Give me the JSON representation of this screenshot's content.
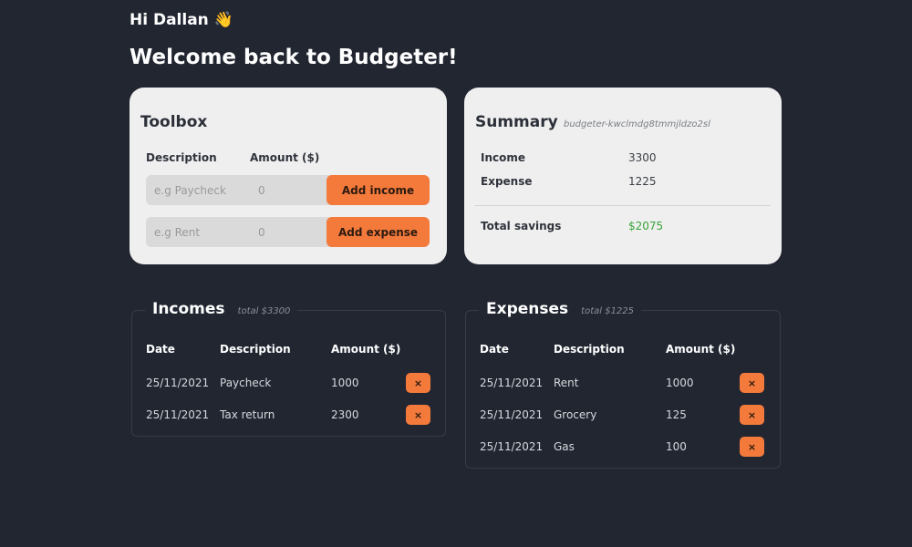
{
  "header": {
    "greeting": "Hi Dallan",
    "wave_emoji": "👋",
    "welcome": "Welcome back to Budgeter!"
  },
  "toolbox": {
    "title": "Toolbox",
    "col_description": "Description",
    "col_amount": "Amount ($)",
    "income_row": {
      "description_placeholder": "e.g Paycheck",
      "amount_placeholder": "0",
      "button_label": "Add income"
    },
    "expense_row": {
      "description_placeholder": "e.g Rent",
      "amount_placeholder": "0",
      "button_label": "Add expense"
    }
  },
  "summary": {
    "title": "Summary",
    "budget_id": "budgeter-kwclmdg8tmmjldzo2sl",
    "income_label": "Income",
    "income_value": "3300",
    "expense_label": "Expense",
    "expense_value": "1225",
    "savings_label": "Total savings",
    "savings_value": "$2075",
    "savings_color": "#3aa33a"
  },
  "incomes": {
    "title": "Incomes",
    "total": "total $3300",
    "headers": {
      "date": "Date",
      "description": "Description",
      "amount": "Amount ($)"
    },
    "rows": [
      {
        "date": "25/11/2021",
        "description": "Paycheck",
        "amount": "1000",
        "delete_label": "×"
      },
      {
        "date": "25/11/2021",
        "description": "Tax return",
        "amount": "2300",
        "delete_label": "×"
      }
    ]
  },
  "expenses": {
    "title": "Expenses",
    "total": "total $1225",
    "headers": {
      "date": "Date",
      "description": "Description",
      "amount": "Amount ($)"
    },
    "rows": [
      {
        "date": "25/11/2021",
        "description": "Rent",
        "amount": "1000",
        "delete_label": "×"
      },
      {
        "date": "25/11/2021",
        "description": "Grocery",
        "amount": "125",
        "delete_label": "×"
      },
      {
        "date": "25/11/2021",
        "description": "Gas",
        "amount": "100",
        "delete_label": "×"
      }
    ]
  },
  "colors": {
    "background": "#212631",
    "card": "#efefef",
    "accent": "#f47a3c"
  }
}
